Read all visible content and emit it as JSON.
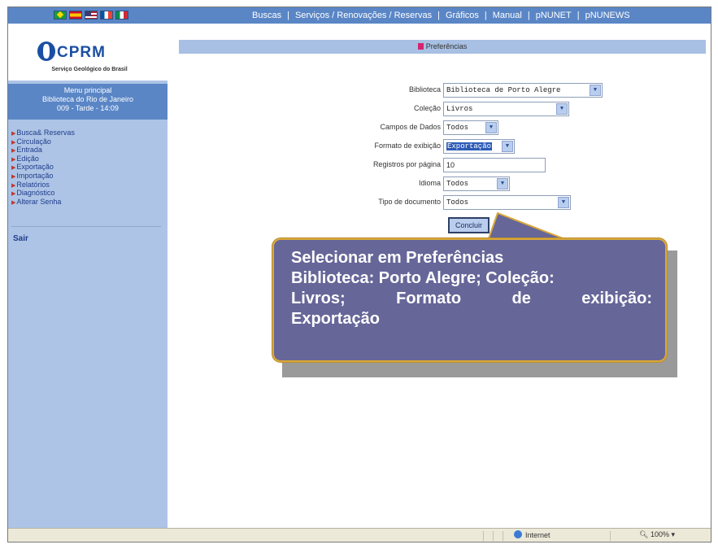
{
  "topnav": {
    "flags": [
      "flag-br-icon",
      "flag-es-icon",
      "flag-us-icon",
      "flag-fr-icon",
      "flag-it-icon"
    ],
    "links": [
      "Buscas",
      "Serviços / Renovações / Reservas",
      "Gráficos",
      "Manual",
      "pNUNET",
      "pNUNEWS"
    ],
    "separator": "|"
  },
  "sidebar": {
    "logo_text": "CPRM",
    "logo_sub": "Serviço Geológico do Brasil",
    "menu_header": {
      "line1": "Menu principal",
      "line2": "Biblioteca do Rio de Janeiro",
      "line3": "009 - Tarde - 14:09"
    },
    "menu_items": [
      "Busca& Reservas",
      "Circulação",
      "Entrada",
      "Edição",
      "Exportação",
      "Importação",
      "Relatórios",
      "Diagnóstico",
      "Alterar Senha"
    ],
    "logout": "Sair"
  },
  "main": {
    "header": "Preferências",
    "fields": {
      "biblioteca": {
        "label": "Biblioteca",
        "value": "Biblioteca de Porto Alegre"
      },
      "colecao": {
        "label": "Coleção",
        "value": "Livros"
      },
      "campos": {
        "label": "Campos de Dados",
        "value": "Todos"
      },
      "formato": {
        "label": "Formato de exibição",
        "value": "Exportação"
      },
      "registros": {
        "label": "Registros por página",
        "value": "10"
      },
      "idioma": {
        "label": "Idioma",
        "value": "Todos"
      },
      "tipo": {
        "label": "Tipo de documento",
        "value": "Todos"
      }
    },
    "submit_label": "Concluir"
  },
  "callout": {
    "line1": "Selecionar em Preferências",
    "line2": "Biblioteca: Porto Alegre; Coleção:",
    "line3_words": [
      "Livros;",
      "Formato",
      "de",
      "exibição:"
    ],
    "line4": "Exportação"
  },
  "statusbar": {
    "zone": "Internet",
    "zoom": "100%"
  },
  "colors": {
    "nav_blue": "#5a86c6",
    "sidebar_bg": "#adc4e6",
    "callout_bg": "#666699",
    "callout_border": "#d9a83a"
  }
}
